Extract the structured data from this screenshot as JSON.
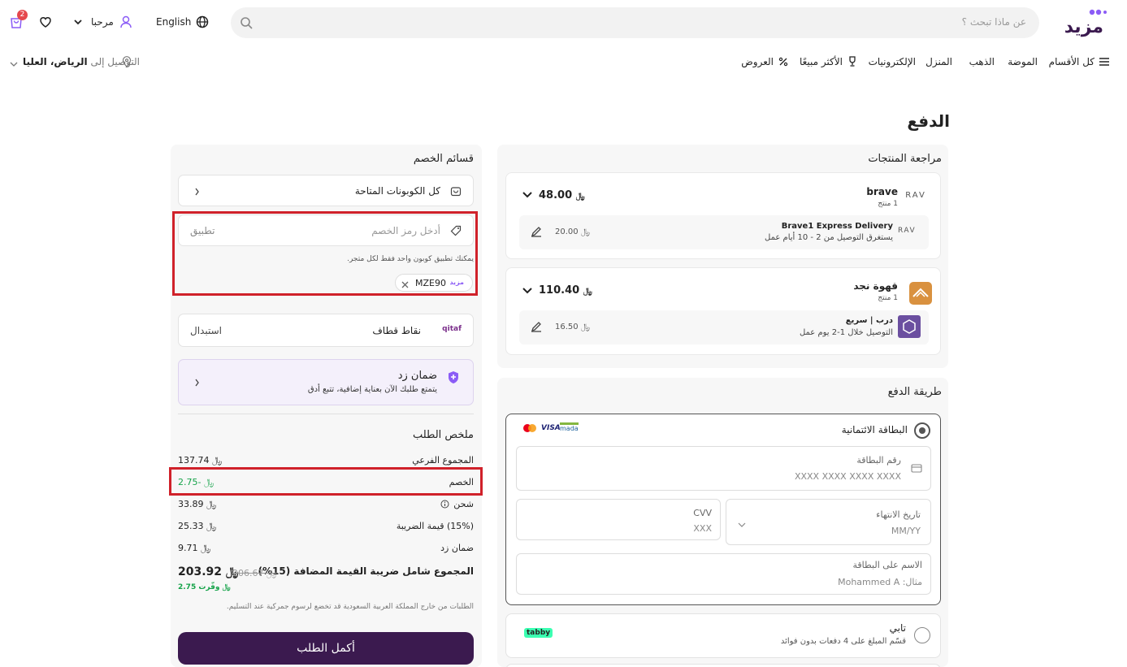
{
  "header": {
    "logo_text": "مزيد",
    "search_placeholder": "عن ماذا تبحث ؟",
    "language": "English",
    "greeting": "مرحبا",
    "cart_count": "2"
  },
  "nav": {
    "all_categories": "كل الأقسام",
    "items": [
      "الموضة",
      "الذهب",
      "المنزل",
      "الإلكترونيات",
      "الأكثر مبيعًا",
      "العروض"
    ],
    "delivery_prefix": "التوصيل إلى",
    "delivery_location": "الرياض، العليا"
  },
  "page_title": "الدفع",
  "products": {
    "title": "مراجعة المنتجات",
    "stores": [
      {
        "name": "brave",
        "count": "1 منتج",
        "total": "48.00",
        "shipping_name": "Brave1 Express Delivery",
        "shipping_note": "يستغرق التوصيل من 2 - 10 أيام عمل",
        "shipping_price": "20.00",
        "logo_text": "RAV"
      },
      {
        "name": "قهوة نجد",
        "count": "1 منتج",
        "total": "110.40",
        "shipping_name": "درب | سريع",
        "shipping_note": "التوصيل خلال 1-2 يوم عمل",
        "shipping_price": "16.50"
      }
    ]
  },
  "payment": {
    "title": "طريقة الدفع",
    "card_option": "البطاقة الائتمانية",
    "card_number_label": "رقم البطاقة",
    "card_number_ph": "XXXX XXXX XXXX XXXX",
    "expiry_label": "تاريخ الانتهاء",
    "expiry_ph": "MM/YY",
    "cvv_label": "CVV",
    "cvv_ph": "XXX",
    "name_label": "الاسم على البطاقة",
    "name_ph": "مثال: Mohammed A",
    "brands": [
      "mada",
      "VISA"
    ],
    "tabby_title": "تابي",
    "tabby_desc": "قسّم المبلغ على 4 دفعات بدون فوائد",
    "tabby_logo": "tabby"
  },
  "discounts": {
    "title": "قسائم الخصم",
    "all_coupons": "كل الكوبونات المتاحة",
    "code_placeholder": "أدخل رمز الخصم",
    "apply": "تطبيق",
    "note": "يمكنك تطبيق كوبون واحد فقط لكل متجر.",
    "applied_code": "MZE90",
    "applied_brand": "مزيد",
    "qitaf_label": "نقاط قطاف",
    "qitaf_logo": "qitaf",
    "qitaf_action": "استبدال",
    "zid_title": "ضمان زد",
    "zid_desc": "يتمتع طلبك الآن بعناية إضافية، تتبع أدق"
  },
  "summary": {
    "title": "ملخص الطلب",
    "rows": [
      {
        "label": "المجموع الفرعي",
        "value": "137.74"
      },
      {
        "label": "الخصم",
        "value": "-2.75"
      },
      {
        "label": "شحن",
        "value": "33.89"
      },
      {
        "label": "(15%) قيمة الضريبة",
        "value": "25.33"
      },
      {
        "label": "ضمان زد",
        "value": "9.71"
      }
    ],
    "total_label": "المجموع شامل ضريبة القيمة المضافة (15%)",
    "total": "203.92",
    "old_total": "206.67",
    "saved": "وفّرت 2.75",
    "customs_note": "الطلبات من خارج المملكة العربية السعودية قد تخضع لرسوم جمركية عند التسليم.",
    "cta": "أكمل الطلب"
  },
  "colors": {
    "brand": "#3b1a4f",
    "accent": "#8b5cf6",
    "highlight": "#d0212a",
    "green": "#16a34a"
  }
}
